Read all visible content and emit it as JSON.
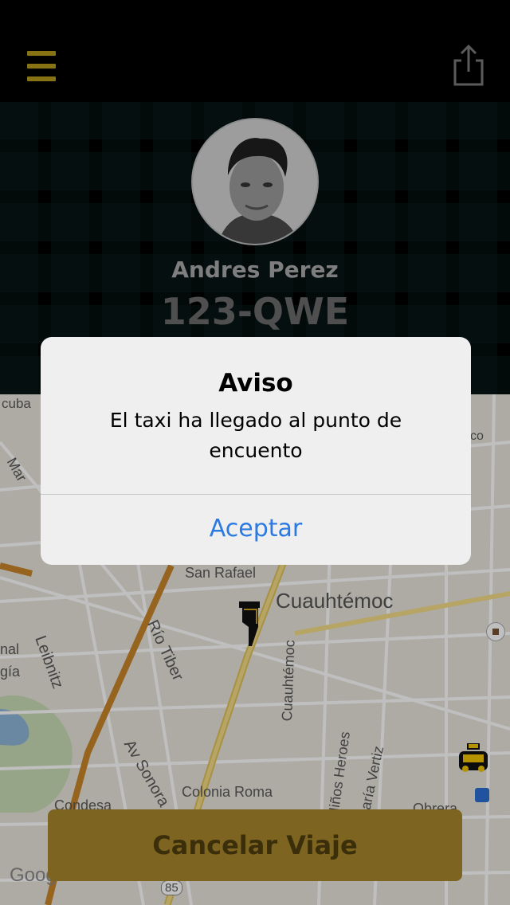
{
  "driver": {
    "name": "Andres Perez",
    "plate": "123-QWE"
  },
  "header": {
    "menu_icon": "hamburger-menu-icon",
    "share_icon": "share-icon"
  },
  "map": {
    "labels": [
      "cuba",
      "San Rafael",
      "Cuauhtémoc",
      "Leibnitz",
      "Río Tiber",
      "Av Sonora",
      "Colonia Roma",
      "Condesa",
      "Cuauhtémoc",
      "Niños Heroes",
      "Sé María Vertiz",
      "Obrera",
      "nal",
      "gía",
      "Mar",
      "co",
      "85",
      "Google"
    ],
    "icons": [
      "pointer-hand-icon",
      "taxi-icon",
      "metro-station-icon",
      "transit-icon"
    ]
  },
  "alert": {
    "title": "Aviso",
    "message": "El taxi ha llegado al punto de encuento",
    "button": "Aceptar"
  },
  "footer": {
    "cancel_label": "Cancelar Viaje"
  },
  "colors": {
    "accent_gold": "#b59a1b",
    "cancel_bg": "#7d6521",
    "alert_button": "#2a7ae2"
  }
}
